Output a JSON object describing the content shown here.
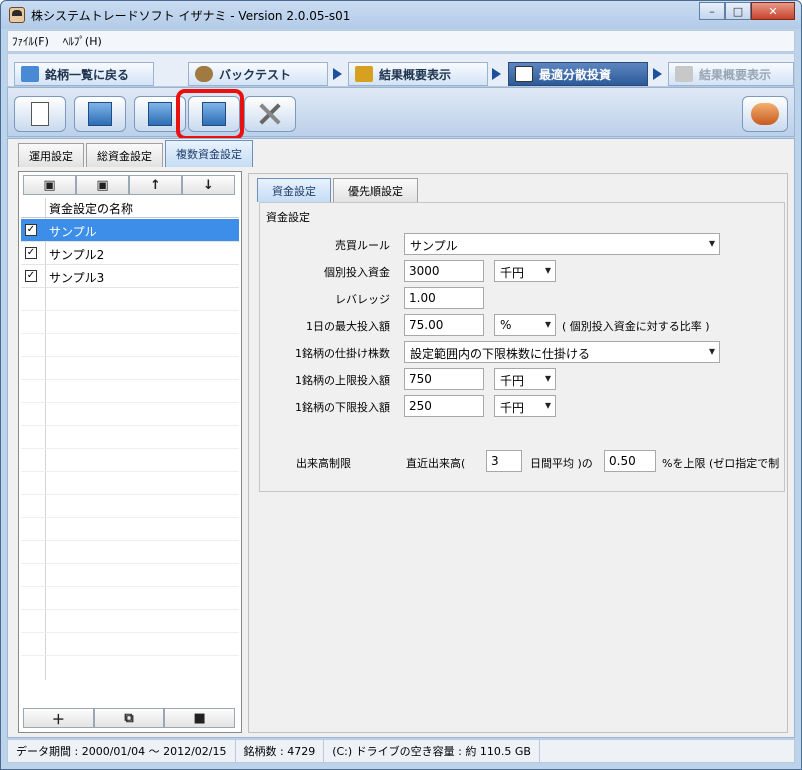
{
  "window": {
    "title": "株システムトレードソフト イザナミ - Version 2.0.05-s01",
    "minimize_icon": "minimize-icon",
    "maximize_icon": "maximize-icon",
    "close_icon": "close-icon"
  },
  "menu": [
    {
      "label": "ﾌｧｲﾙ(F)"
    },
    {
      "label": "ﾍﾙﾌﾟ(H)"
    }
  ],
  "nav": {
    "back_label": "銘柄一覧に戻る",
    "backtest_label": "バックテスト",
    "results1_label": "結果概要表示",
    "optimize_label": "最適分散投資",
    "results2_label": "結果概要表示"
  },
  "toolbar": {
    "icons": [
      "new-doc-icon",
      "yen-edit-icon",
      "export-icon",
      "import-icon",
      "tools-icon",
      "exit-icon"
    ]
  },
  "tabs": {
    "t1": "運用設定",
    "t2": "総資金設定",
    "t3": "複数資金設定"
  },
  "list": {
    "header": "資金設定の名称",
    "items": [
      {
        "label": "サンプル",
        "checked": true
      },
      {
        "label": "サンプル2",
        "checked": true
      },
      {
        "label": "サンプル3",
        "checked": true
      }
    ],
    "top_buttons": [
      "save-icon",
      "save-as-icon",
      "up-arrow-icon",
      "down-arrow-icon"
    ],
    "bottom_buttons": [
      "add-icon",
      "copy-icon",
      "trash-icon"
    ]
  },
  "right_tabs": {
    "tab1": "資金設定",
    "tab2": "優先順設定"
  },
  "group": {
    "title": "資金設定",
    "trade_rule_label": "売買ルール",
    "trade_rule_value": "サンプル",
    "individual_label": "個別投入資金",
    "individual_value": "3000",
    "individual_unit": "千円",
    "leverage_label": "レバレッジ",
    "leverage_value": "1.00",
    "max_daily_label": "1日の最大投入額",
    "max_daily_value": "75.00",
    "max_daily_unit": "%",
    "max_daily_note": "( 個別投入資金に対する比率 )",
    "shares_label": "1銘柄の仕掛け株数",
    "shares_value": "設定範囲内の下限株数に仕掛ける",
    "upper_label": "1銘柄の上限投入額",
    "upper_value": "750",
    "upper_unit": "千円",
    "lower_label": "1銘柄の下限投入額",
    "lower_value": "250",
    "lower_unit": "千円",
    "volume_label": "出来高制限",
    "volume_pre": "直近出来高(",
    "volume_days": "3",
    "volume_mid": "日間平均 )の",
    "volume_ratio": "0.50",
    "volume_post": "%を上限 (ゼロ指定で制"
  },
  "status": {
    "period": "データ期間 : 2000/01/04 〜 2012/02/15",
    "count": "銘柄数 : 4729",
    "drive": "(C:) ドライブの空き容量 : 約 110.5 GB"
  }
}
